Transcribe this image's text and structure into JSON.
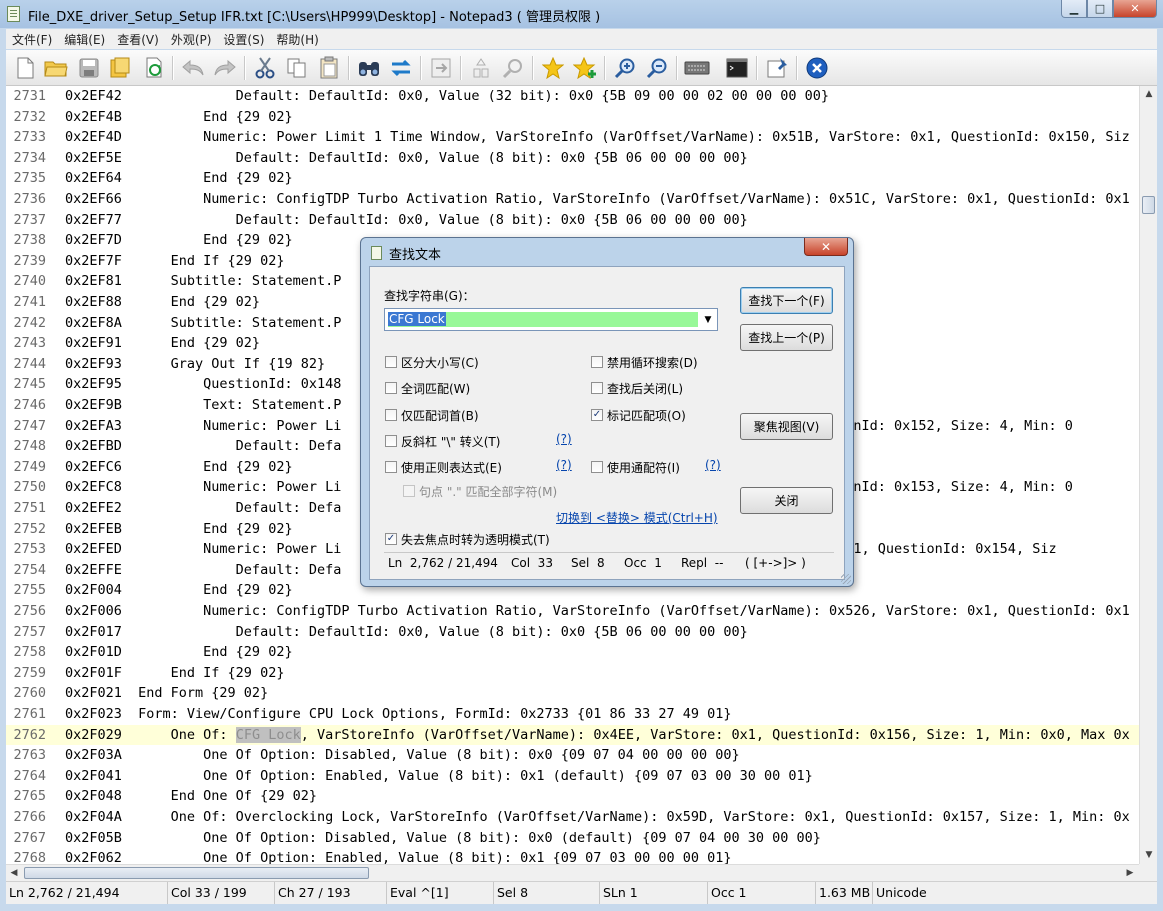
{
  "window": {
    "title": "File_DXE_driver_Setup_Setup IFR.txt [C:\\Users\\HP999\\Desktop] - Notepad3 ( 管理员权限 )",
    "caption": {
      "minimize": "▁",
      "maximize": "□",
      "close": "✕"
    }
  },
  "menu": [
    "文件(F)",
    "编辑(E)",
    "查看(V)",
    "外观(P)",
    "设置(S)",
    "帮助(H)"
  ],
  "toolbar_icons": [
    "new-file-icon",
    "open-folder-icon",
    "save-icon",
    "save-as-icon",
    "refresh-icon",
    "undo-icon",
    "redo-icon",
    "cut-icon",
    "copy-icon",
    "paste-icon",
    "find-icon",
    "replace-icon",
    "goto-icon",
    "zoom-view-icon",
    "find-next-icon",
    "star-icon",
    "star-add-icon",
    "zoom-in-icon",
    "zoom-out-icon",
    "keyboard-icon",
    "terminal-icon",
    "pin-icon",
    "exit-icon"
  ],
  "editor": {
    "lines": [
      {
        "n": "2731",
        "code": "0x2EF42              Default: DefaultId: 0x0, Value (32 bit): 0x0 {5B 09 00 00 02 00 00 00 00}"
      },
      {
        "n": "2732",
        "code": "0x2EF4B          End {29 02}"
      },
      {
        "n": "2733",
        "code": "0x2EF4D          Numeric: Power Limit 1 Time Window, VarStoreInfo (VarOffset/VarName): 0x51B, VarStore: 0x1, QuestionId: 0x150, Siz"
      },
      {
        "n": "2734",
        "code": "0x2EF5E              Default: DefaultId: 0x0, Value (8 bit): 0x0 {5B 06 00 00 00 00}"
      },
      {
        "n": "2735",
        "code": "0x2EF64          End {29 02}"
      },
      {
        "n": "2736",
        "code": "0x2EF66          Numeric: ConfigTDP Turbo Activation Ratio, VarStoreInfo (VarOffset/VarName): 0x51C, VarStore: 0x1, QuestionId: 0x1"
      },
      {
        "n": "2737",
        "code": "0x2EF77              Default: DefaultId: 0x0, Value (8 bit): 0x0 {5B 06 00 00 00 00}"
      },
      {
        "n": "2738",
        "code": "0x2EF7D          End {29 02}"
      },
      {
        "n": "2739",
        "code": "0x2EF7F      End If {29 02}"
      },
      {
        "n": "2740",
        "code": "0x2EF81      Subtitle: Statement.P"
      },
      {
        "n": "2741",
        "code": "0x2EF88      End {29 02}"
      },
      {
        "n": "2742",
        "code": "0x2EF8A      Subtitle: Statement.P"
      },
      {
        "n": "2743",
        "code": "0x2EF91      End {29 02}"
      },
      {
        "n": "2744",
        "code": "0x2EF93      Gray Out If {19 82}"
      },
      {
        "n": "2745",
        "code": "0x2EF95          QuestionId: 0x148"
      },
      {
        "n": "2746",
        "code": "0x2EF9B          Text: Statement.P                                                       }"
      },
      {
        "n": "2747",
        "code": "0x2EFA3          Numeric: Power Li                                                        QuestionId: 0x152, Size: 4, Min: 0"
      },
      {
        "n": "2748",
        "code": "0x2EFBD              Default: Defa"
      },
      {
        "n": "2749",
        "code": "0x2EFC6          End {29 02}"
      },
      {
        "n": "2750",
        "code": "0x2EFC8          Numeric: Power Li                                                        QuestionId: 0x153, Size: 4, Min: 0"
      },
      {
        "n": "2751",
        "code": "0x2EFE2              Default: Defa"
      },
      {
        "n": "2752",
        "code": "0x2EFEB          End {29 02}"
      },
      {
        "n": "2753",
        "code": "0x2EFED          Numeric: Power Li                                                     rStore: 0x1, QuestionId: 0x154, Siz"
      },
      {
        "n": "2754",
        "code": "0x2EFFE              Default: Defa"
      },
      {
        "n": "2755",
        "code": "0x2F004          End {29 02}"
      },
      {
        "n": "2756",
        "code": "0x2F006          Numeric: ConfigTDP Turbo Activation Ratio, VarStoreInfo (VarOffset/VarName): 0x526, VarStore: 0x1, QuestionId: 0x1"
      },
      {
        "n": "2757",
        "code": "0x2F017              Default: DefaultId: 0x0, Value (8 bit): 0x0 {5B 06 00 00 00 00}"
      },
      {
        "n": "2758",
        "code": "0x2F01D          End {29 02}"
      },
      {
        "n": "2759",
        "code": "0x2F01F      End If {29 02}"
      },
      {
        "n": "2760",
        "code": "0x2F021  End Form {29 02}"
      },
      {
        "n": "2761",
        "code": "0x2F023  Form: View/Configure CPU Lock Options, FormId: 0x2733 {01 86 33 27 49 01}"
      },
      {
        "n": "2762",
        "pre": "0x2F029      One Of: ",
        "match": "CFG Lock",
        "post": ", VarStoreInfo (VarOffset/VarName): 0x4EE, VarStore: 0x1, QuestionId: 0x156, Size: 1, Min: 0x0, Max 0x"
      },
      {
        "n": "2763",
        "code": "0x2F03A          One Of Option: Disabled, Value (8 bit): 0x0 {09 07 04 00 00 00 00}"
      },
      {
        "n": "2764",
        "code": "0x2F041          One Of Option: Enabled, Value (8 bit): 0x1 (default) {09 07 03 00 30 00 01}"
      },
      {
        "n": "2765",
        "code": "0x2F048      End One Of {29 02}"
      },
      {
        "n": "2766",
        "code": "0x2F04A      One Of: Overclocking Lock, VarStoreInfo (VarOffset/VarName): 0x59D, VarStore: 0x1, QuestionId: 0x157, Size: 1, Min: 0x"
      },
      {
        "n": "2767",
        "code": "0x2F05B          One Of Option: Disabled, Value (8 bit): 0x0 (default) {09 07 04 00 30 00 00}"
      },
      {
        "n": "2768",
        "code": "0x2F062          One Of Option: Enabled, Value (8 bit): 0x1 {09 07 03 00 00 00 01}"
      }
    ]
  },
  "statusbar": {
    "ln": "Ln  2,762 / 21,494",
    "col": "Col  33 / 199",
    "ch": "Ch  27 / 193",
    "eval": "Eval  ^[1]",
    "sel": "Sel  8",
    "sln": "SLn  1",
    "occ": "Occ  1",
    "size": "1.63 MB",
    "encoding": "Unicode"
  },
  "find_dialog": {
    "title": "查找文本",
    "search_label": "查找字符串(G)：",
    "search_value": "CFG Lock",
    "options_left": [
      {
        "label": "区分大小写(C)",
        "checked": false
      },
      {
        "label": "全词匹配(W)",
        "checked": false
      },
      {
        "label": "仅匹配词首(B)",
        "checked": false
      },
      {
        "label": "反斜杠 \"\\\" 转义(T)",
        "checked": false
      },
      {
        "label": "使用正则表达式(E)",
        "checked": false
      }
    ],
    "option_dot": "句点 \".\" 匹配全部字符(M)",
    "options_right": [
      {
        "label": "禁用循环搜索(D)",
        "checked": false
      },
      {
        "label": "查找后关闭(L)",
        "checked": false
      },
      {
        "label": "标记匹配项(O)",
        "checked": true
      },
      {
        "label": "使用通配符(I)",
        "checked": false
      }
    ],
    "help_link": "(?)",
    "switch_link": "切换到 <替换> 模式(Ctrl+H)",
    "transparent_option": "失去焦点时转为透明模式(T)",
    "buttons": {
      "find_next": "查找下一个(F)",
      "find_prev": "查找上一个(P)",
      "focus_view": "聚焦视图(V)",
      "close": "关闭"
    },
    "status": {
      "ln": "Ln  2,762 / 21,494",
      "col": "Col  33",
      "sel": "Sel  8",
      "occ": "Occ  1",
      "repl": "Repl  --",
      "extra": "( [+->]> )"
    }
  }
}
